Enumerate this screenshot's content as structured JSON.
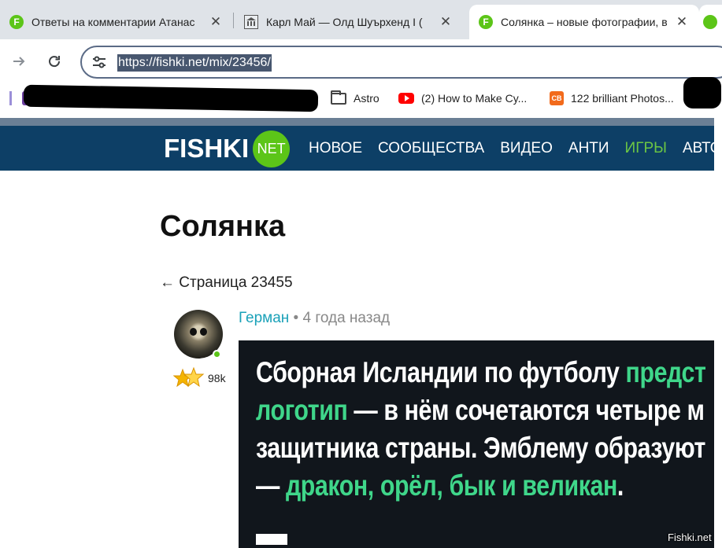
{
  "tabs": [
    {
      "title": "Ответы на комментарии Атанас",
      "favicon": "fishki-f-icon",
      "active": false
    },
    {
      "title": "Карл Май — Олд Шуърхенд I (",
      "favicon": "museum-icon",
      "active": false
    },
    {
      "title": "Солянка – новые фотографии, в",
      "favicon": "fishki-f-icon",
      "active": true
    }
  ],
  "tab_close_glyph": "✕",
  "address_bar": {
    "url": "https://fishki.net/mix/23456/"
  },
  "bookmarks": [
    {
      "label": "Astro",
      "icon": "folder-icon"
    },
    {
      "label": "(2) How to Make Cy...",
      "icon": "youtube-icon"
    },
    {
      "label": "122 brilliant Photos...",
      "icon": "cb-icon"
    }
  ],
  "site": {
    "logo_text": "FISHKI",
    "logo_badge": "NET",
    "nav": [
      "НОВОЕ",
      "СООБЩЕСТВА",
      "ВИДЕО",
      "АНТИ",
      "ИГРЫ",
      "АВТО"
    ]
  },
  "page": {
    "title": "Солянка",
    "prev_page": "← Страница 23455"
  },
  "post": {
    "author": "Герман",
    "meta": " • 4 года назад",
    "rating": "98k",
    "image_text": {
      "line1_a": "Сборная Исландии по футболу ",
      "line1_b": "предст",
      "line2_a": "логотип",
      "line2_b": " — в нём сочетаются четыре м",
      "line3": "защитника страны. Эмблему образуют",
      "line4_a": "— ",
      "line4_b": "дракон, орёл, бык и великан",
      "line4_c": "."
    },
    "watermark": "Fishki.net"
  },
  "colors": {
    "header_bg": "#0d3f66",
    "accent_green": "#5cc518",
    "author_link": "#1aa1b8",
    "image_highlight": "#3fd68a"
  }
}
